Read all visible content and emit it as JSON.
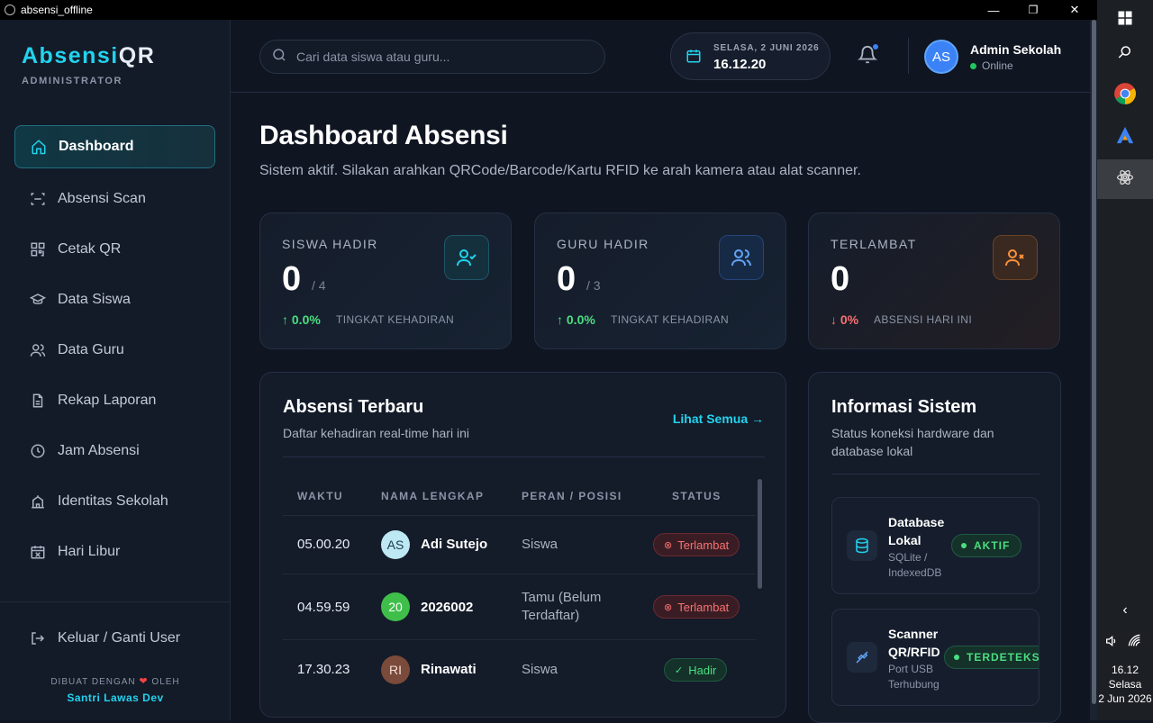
{
  "window": {
    "title": "absensi_offline",
    "minimize": "—",
    "maximize": "❐",
    "close": "✕"
  },
  "sidebar": {
    "brand_main": "Absensi",
    "brand_accent": "QR",
    "role": "ADMINISTRATOR",
    "items": [
      {
        "label": "Dashboard",
        "icon": "home-icon",
        "active": true
      },
      {
        "label": "Absensi Scan",
        "icon": "scan-icon"
      },
      {
        "label": "Cetak QR",
        "icon": "qr-icon"
      },
      {
        "label": "Data Siswa",
        "icon": "graduation-cap-icon"
      },
      {
        "label": "Data Guru",
        "icon": "users-icon"
      },
      {
        "label": "Rekap Laporan",
        "icon": "file-icon"
      },
      {
        "label": "Jam Absensi",
        "icon": "clock-icon"
      },
      {
        "label": "Identitas Sekolah",
        "icon": "school-icon"
      },
      {
        "label": "Hari Libur",
        "icon": "calendar-x-icon"
      }
    ],
    "logout_label": "Keluar / Ganti User",
    "credit_prefix": "DIBUAT DENGAN",
    "credit_suffix": "OLEH",
    "credit_author": "Santri Lawas Dev"
  },
  "header": {
    "search_placeholder": "Cari data siswa atau guru...",
    "date": "SELASA, 2 JUNI 2026",
    "time": "16.12.20",
    "avatar_initials": "AS",
    "user_name": "Admin Sekolah",
    "user_status": "Online"
  },
  "main": {
    "title": "Dashboard Absensi",
    "description": "Sistem aktif. Silakan arahkan QRCode/Barcode/Kartu RFID ke arah kamera atau alat scanner.",
    "stats": [
      {
        "label": "SISWA HADIR",
        "value": "0",
        "total": "/ 4",
        "trend": "↑ 0.0%",
        "trend_label": "TINGKAT KEHADIRAN"
      },
      {
        "label": "GURU HADIR",
        "value": "0",
        "total": "/ 3",
        "trend": "↑ 0.0%",
        "trend_label": "TINGKAT KEHADIRAN"
      },
      {
        "label": "TERLAMBAT",
        "value": "0",
        "trend": "↓ 0%",
        "trend_label": "ABSENSI HARI INI"
      }
    ],
    "recent": {
      "title": "Absensi Terbaru",
      "subtitle": "Daftar kehadiran real-time hari ini",
      "see_all": "Lihat Semua →",
      "columns": [
        "WAKTU",
        "NAMA LENGKAP",
        "PERAN / POSISI",
        "STATUS"
      ],
      "rows": [
        {
          "time": "05.00.20",
          "initials": "AS",
          "name": "Adi Sutejo",
          "role": "Siswa",
          "status": "Terlambat"
        },
        {
          "time": "04.59.59",
          "initials": "20",
          "name": "2026002",
          "role": "Tamu (Belum Terdaftar)",
          "status": "Terlambat"
        },
        {
          "time": "17.30.23",
          "initials": "RI",
          "name": "Rinawati",
          "role": "Siswa",
          "status": "Hadir"
        }
      ]
    },
    "info": {
      "title": "Informasi Sistem",
      "subtitle": "Status koneksi hardware dan database lokal",
      "cards": [
        {
          "name": "Database Lokal",
          "desc": "SQLite / IndexedDB",
          "status": "AKTIF"
        },
        {
          "name": "Scanner QR/RFID",
          "desc": "Port USB Terhubung",
          "status": "TERDETEKSI"
        }
      ]
    }
  },
  "taskbar": {
    "time": "16.12",
    "day": "Selasa",
    "date": "2 Jun 2026"
  },
  "colors": {
    "accent": "#22d3ee",
    "success": "#4ade80",
    "danger": "#f87171",
    "primary": "#3b82f6"
  }
}
